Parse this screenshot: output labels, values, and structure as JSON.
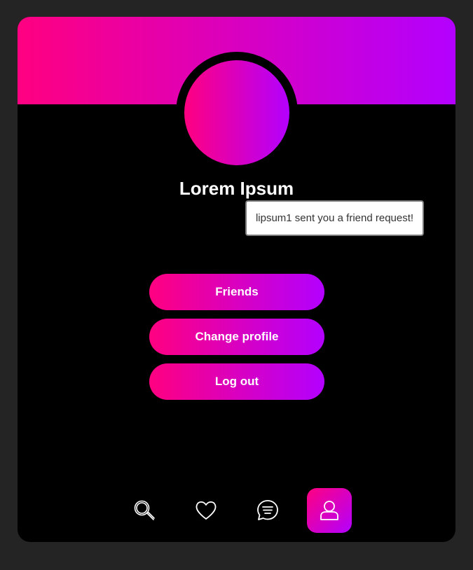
{
  "colors": {
    "gradient_start": "#ff0080",
    "gradient_end": "#b300ff",
    "card_bg": "#000000",
    "page_bg": "#242424"
  },
  "profile": {
    "name": "Lorem Ipsum"
  },
  "notification": {
    "text": "lipsum1 sent you a friend request!"
  },
  "actions": [
    {
      "label": "Friends"
    },
    {
      "label": "Change profile"
    },
    {
      "label": "Log out"
    }
  ],
  "bottom_nav": {
    "items": [
      {
        "icon": "search-icon",
        "active": false
      },
      {
        "icon": "heart-icon",
        "active": false
      },
      {
        "icon": "chat-icon",
        "active": false
      },
      {
        "icon": "user-icon",
        "active": true
      }
    ]
  }
}
